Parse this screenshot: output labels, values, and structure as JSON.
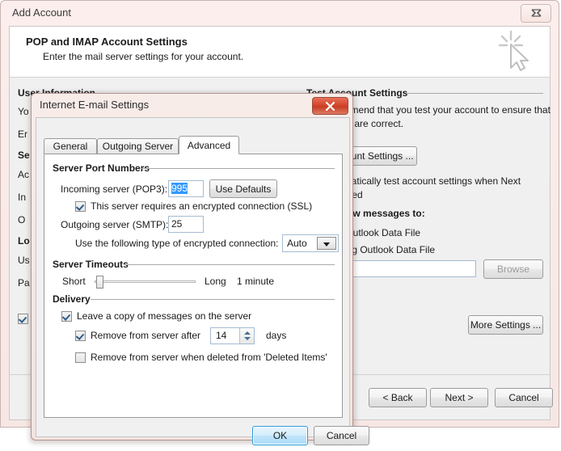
{
  "outer_window": {
    "title": "Add Account",
    "close_label": "Close",
    "header": {
      "title": "POP and IMAP Account Settings",
      "subtitle": "Enter the mail server settings for your account.",
      "icon": "wizard-cursor-sparkle-icon"
    },
    "left_column": {
      "user_information_heading": "User Information",
      "fields": [
        "Yo",
        "Er"
      ],
      "server_information_heading": "Se",
      "server_fields": [
        "Ac",
        "In",
        "O"
      ],
      "logon_information_heading": "Lo",
      "logon_fields": [
        "Us",
        "Pa"
      ]
    },
    "right_column": {
      "test_account_settings_heading": "Test Account Settings",
      "description_line1": "We recommend that you test your account to ensure that",
      "description_line2": "the entries are correct.",
      "test_button": "Test Account Settings ...",
      "auto_test_line1": "Automatically test account settings when Next",
      "auto_test_line2": "is clicked",
      "deliver_heading": "Deliver new messages to:",
      "radio_new_file": "New Outlook Data File",
      "radio_existing_file": "Existing Outlook Data File",
      "path_value": "",
      "browse_button": "Browse",
      "more_settings_button": "More Settings ..."
    },
    "footer": {
      "back_button": "< Back",
      "next_button": "Next >",
      "cancel_button": "Cancel"
    }
  },
  "modal": {
    "title": "Internet E-mail Settings",
    "close_label": "Close",
    "tabs": [
      {
        "label": "General",
        "active": false
      },
      {
        "label": "Outgoing Server",
        "active": false
      },
      {
        "label": "Advanced",
        "active": true
      }
    ],
    "server_port_numbers": {
      "heading": "Server Port Numbers",
      "incoming_label": "Incoming server (POP3):",
      "incoming_value": "995",
      "incoming_selected": true,
      "use_defaults_button": "Use Defaults",
      "ssl_checkbox_label": "This server requires an encrypted connection (SSL)",
      "ssl_checked": true,
      "outgoing_label": "Outgoing server (SMTP):",
      "outgoing_value": "25",
      "encryption_label": "Use the following type of encrypted connection:",
      "encryption_value": "Auto"
    },
    "server_timeouts": {
      "heading": "Server Timeouts",
      "short_label": "Short",
      "long_label": "Long",
      "value_label": "1 minute",
      "slider_position_percent": 4
    },
    "delivery": {
      "heading": "Delivery",
      "leave_copy_label": "Leave a copy of messages on the server",
      "leave_copy_checked": true,
      "remove_after_label": "Remove from server after",
      "remove_after_checked": true,
      "remove_after_days": "14",
      "days_label": "days",
      "remove_deleted_label": "Remove from server when deleted from 'Deleted Items'",
      "remove_deleted_checked": false
    },
    "buttons": {
      "ok": "OK",
      "cancel": "Cancel"
    }
  }
}
